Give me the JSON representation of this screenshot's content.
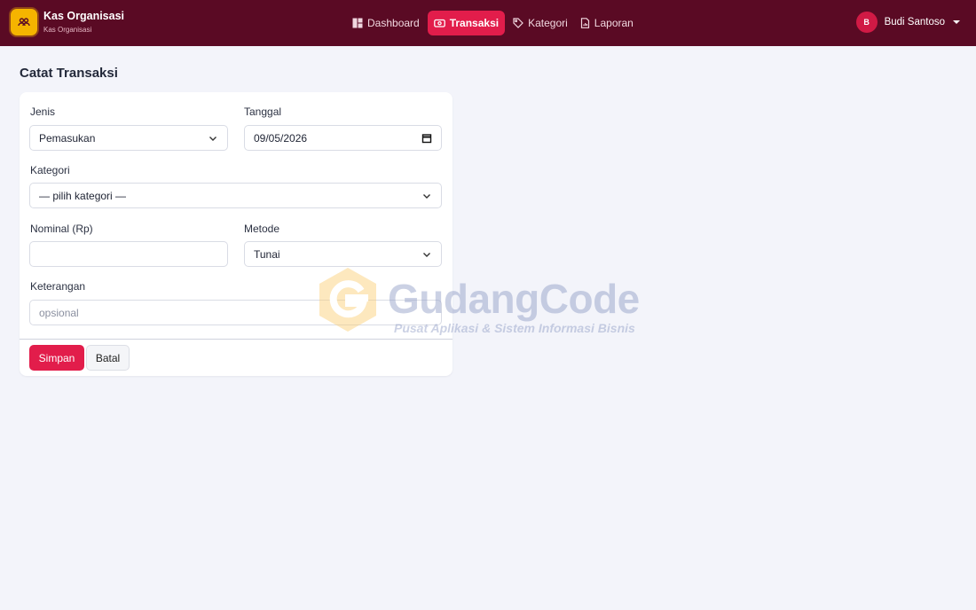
{
  "app": {
    "title": "Kas Organisasi",
    "subtitle": "Kas Organisasi",
    "logo_icon": "users-icon",
    "brand_color": "#5a0a24",
    "accent_color": "#e21d4b"
  },
  "nav": {
    "items": [
      {
        "label": "Dashboard",
        "icon": "dashboard-icon",
        "active": false
      },
      {
        "label": "Transaksi",
        "icon": "cash-icon",
        "active": true
      },
      {
        "label": "Kategori",
        "icon": "tag-icon",
        "active": false
      },
      {
        "label": "Laporan",
        "icon": "report-icon",
        "active": false
      }
    ]
  },
  "user": {
    "initial": "B",
    "name": "Budi Santoso"
  },
  "page": {
    "title": "Catat Transaksi"
  },
  "form": {
    "jenis": {
      "label": "Jenis",
      "value": "Pemasukan"
    },
    "tanggal": {
      "label": "Tanggal",
      "value": "09/05/2026"
    },
    "kategori": {
      "label": "Kategori",
      "value": "— pilih kategori —"
    },
    "nominal": {
      "label": "Nominal (Rp)",
      "value": ""
    },
    "metode": {
      "label": "Metode",
      "value": "Tunai"
    },
    "keterangan": {
      "label": "Keterangan",
      "placeholder": "opsional",
      "value": ""
    },
    "submit_label": "Simpan",
    "cancel_label": "Batal"
  },
  "watermark": {
    "name": "GudangCode",
    "tagline": "Pusat Aplikasi & Sistem Informasi Bisnis"
  }
}
